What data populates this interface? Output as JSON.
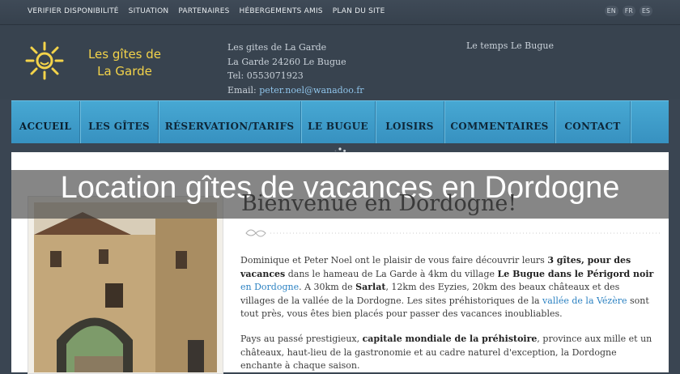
{
  "topbar": {
    "links": [
      "VERIFIER DISPONIBILITÉ",
      "SITUATION",
      "PARTENAIRES",
      "HÉBERGEMENTS AMIS",
      "PLAN DU SITE"
    ],
    "langs": [
      "EN",
      "FR",
      "ES"
    ]
  },
  "header": {
    "logo_line1": "Les gîtes de",
    "logo_line2": "La Garde",
    "contact_name": "Les gites de La Garde",
    "contact_address": "La Garde 24260 Le Bugue",
    "contact_tel": "Tel: 0553071923",
    "contact_email_label": "Email: ",
    "contact_email": "peter.noel@wanadoo.fr",
    "weather": "Le temps Le Bugue"
  },
  "nav": {
    "items": [
      "ACCUEIL",
      "LES GÎTES",
      "RÉSERVATION/TARIFS",
      "LE BUGUE",
      "LOISIRS",
      "COMMENTAIRES",
      "CONTACT"
    ]
  },
  "banner": {
    "title": "Location gîtes de vacances en Dordogne"
  },
  "main": {
    "welcome": "Bienvenue en Dordogne!",
    "p1": {
      "t1": "Dominique et Peter Noel ont le plaisir de vous faire découvrir leurs ",
      "b1": "3 gîtes, pour des vacances",
      "t2": " dans le hameau de La Garde à 4km du village ",
      "b2": "Le Bugue dans le Périgord noir",
      "t3": " ",
      "l1": "en Dordogne",
      "t4": ". A 30km de ",
      "b3": "Sarlat",
      "t5": ", 12km des Eyzies, 20km des beaux châteaux et des villages de la vallée de la Dordogne. Les sites préhistoriques de la ",
      "l2": "vallée de la Vézère",
      "t6": " sont tout près, vous êtes bien placés pour passer des vacances inoubliables."
    },
    "p2": {
      "t1": "Pays au passé prestigieux, ",
      "b1": "capitale mondiale de la préhistoire",
      "t2": ", province aux mille et un châteaux, haut-lieu de la gastronomie et au cadre naturel d'exception, la Dordogne enchante à chaque saison."
    }
  },
  "colors": {
    "nav_bg": "#3f9ecb",
    "logo_yellow": "#f3d34a",
    "link_blue": "#2c82c2",
    "header_bg": "#38434f"
  }
}
